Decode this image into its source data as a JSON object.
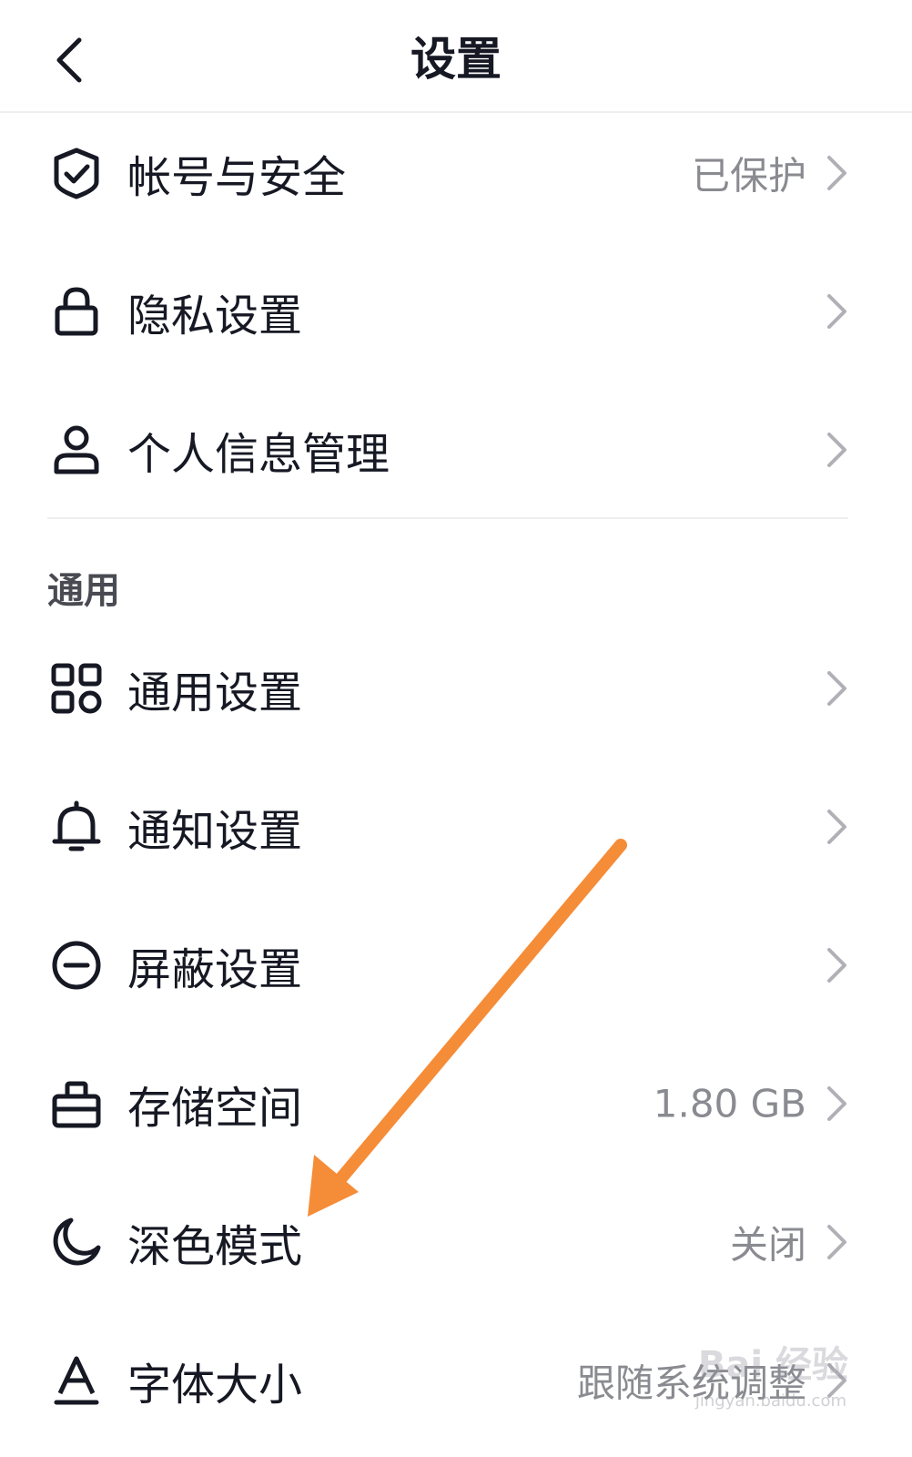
{
  "header": {
    "title": "设置"
  },
  "account_section": {
    "items": [
      {
        "label": "帐号与安全",
        "value": "已保护",
        "icon": "shield-check-icon"
      },
      {
        "label": "隐私设置",
        "value": "",
        "icon": "lock-icon"
      },
      {
        "label": "个人信息管理",
        "value": "",
        "icon": "person-icon"
      }
    ]
  },
  "general_section": {
    "title": "通用",
    "items": [
      {
        "label": "通用设置",
        "value": "",
        "icon": "grid-icon"
      },
      {
        "label": "通知设置",
        "value": "",
        "icon": "bell-icon"
      },
      {
        "label": "屏蔽设置",
        "value": "",
        "icon": "minus-circle-icon"
      },
      {
        "label": "存储空间",
        "value": "1.80 GB",
        "icon": "storage-box-icon"
      },
      {
        "label": "深色模式",
        "value": "关闭",
        "icon": "moon-icon"
      },
      {
        "label": "字体大小",
        "value": "跟随系统调整",
        "icon": "font-size-icon"
      }
    ]
  },
  "annotation": {
    "arrow_color": "#f58c38"
  },
  "watermark": {
    "text": "Bai 经验",
    "url": "jingyan.baidu.com"
  },
  "colors": {
    "text": "#161823",
    "secondary": "#8a8b91",
    "divider": "#efefef"
  }
}
